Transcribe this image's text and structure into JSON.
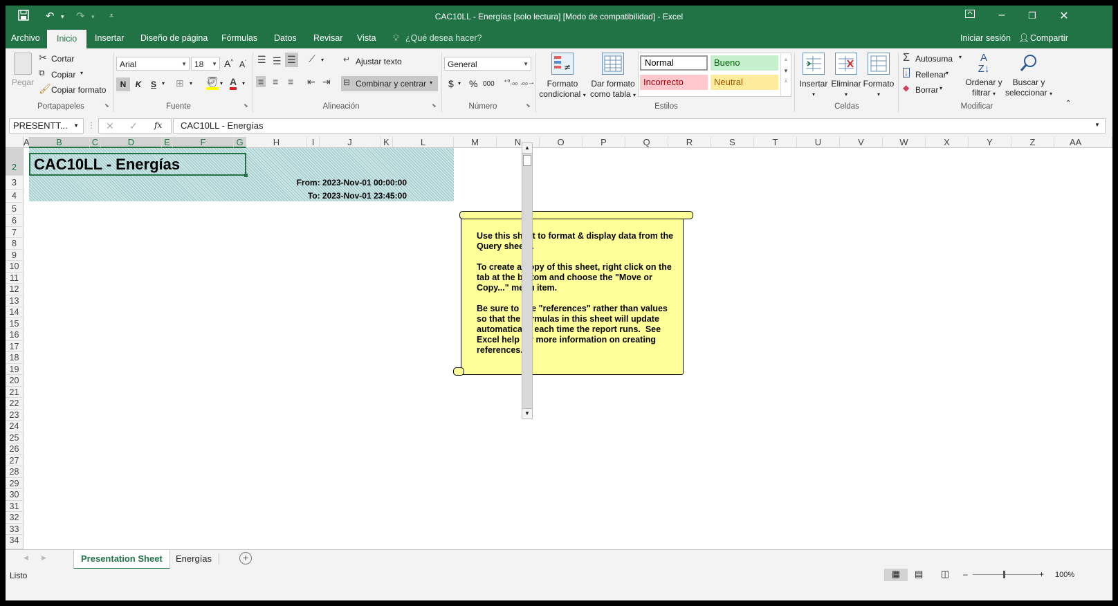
{
  "window": {
    "title": "CAC10LL - Energías  [solo lectura]  [Modo de compatibilidad] - Excel",
    "accent": "#217346"
  },
  "quick_access": {
    "save_icon": "save-icon",
    "undo_icon": "undo-icon",
    "redo_icon": "redo-icon",
    "customize_icon": "customize-icon"
  },
  "tabs": [
    {
      "label": "Archivo"
    },
    {
      "label": "Inicio"
    },
    {
      "label": "Insertar"
    },
    {
      "label": "Diseño de página"
    },
    {
      "label": "Fórmulas"
    },
    {
      "label": "Datos"
    },
    {
      "label": "Revisar"
    },
    {
      "label": "Vista"
    }
  ],
  "tell_me": "¿Qué desea hacer?",
  "account": {
    "signin": "Iniciar sesión",
    "share": "Compartir"
  },
  "ribbon": {
    "clipboard": {
      "paste": "Pegar",
      "cut": "Cortar",
      "copy": "Copiar",
      "format_painter": "Copiar formato",
      "label": "Portapapeles"
    },
    "font": {
      "name": "Arial",
      "size": "18",
      "bold": "N",
      "italic": "K",
      "underline": "S",
      "label": "Fuente"
    },
    "alignment": {
      "wrap": "Ajustar texto",
      "merge": "Combinar y centrar",
      "label": "Alineación"
    },
    "number": {
      "format": "General",
      "currency": "$",
      "percent": "%",
      "thousands": "000",
      "label": "Número"
    },
    "styles": {
      "conditional": [
        "Formato",
        "condicional"
      ],
      "as_table": [
        "Dar formato",
        "como tabla"
      ],
      "normal": "Normal",
      "good": "Bueno",
      "bad": "Incorrecto",
      "neutral": "Neutral",
      "label": "Estilos"
    },
    "cells": {
      "insert": "Insertar",
      "delete": "Eliminar",
      "format": "Formato",
      "label": "Celdas"
    },
    "editing": {
      "autosum": "Autosuma",
      "fill": "Rellenar",
      "clear": "Borrar",
      "sort": [
        "Ordenar y",
        "filtrar"
      ],
      "find": [
        "Buscar y",
        "seleccionar"
      ],
      "label": "Modificar"
    }
  },
  "formula_bar": {
    "name_box": "PRESENTT...",
    "fx": "fx",
    "content": "CAC10LL - Energías"
  },
  "columns": [
    "A",
    "B",
    "C",
    "D",
    "E",
    "F",
    "G",
    "H",
    "I",
    "J",
    "K",
    "L",
    "M",
    "N",
    "O",
    "P",
    "Q",
    "R",
    "S",
    "T",
    "U",
    "V",
    "W",
    "X",
    "Y",
    "Z",
    "AA"
  ],
  "rows": [
    "2",
    "3",
    "4",
    "5",
    "6",
    "7",
    "8",
    "9",
    "10",
    "11",
    "12",
    "13",
    "14",
    "15",
    "16",
    "17",
    "18",
    "19",
    "20",
    "21",
    "22",
    "23",
    "24",
    "25",
    "26",
    "27",
    "28",
    "29",
    "30",
    "31",
    "32",
    "33",
    "34"
  ],
  "sheet": {
    "title": "CAC10LL - Energías",
    "from": "From: 2023-Nov-01 00:00:00",
    "to": "To: 2023-Nov-01 23:45:00",
    "note": "Use this sheet to format & display data from the Query sheets.\n\nTo create a copy of this sheet, right click on the tab at the bottom and choose the \"Move or Copy...\" menu item.\n\nBe sure to use \"references\" rather than values so that the formulas in this sheet will update automatically each time the report runs.  See Excel help for more information on creating references."
  },
  "sheet_tabs": [
    {
      "label": "Presentation Sheet"
    },
    {
      "label": "Energías"
    }
  ],
  "status": {
    "ready": "Listo",
    "zoom": "100%"
  }
}
